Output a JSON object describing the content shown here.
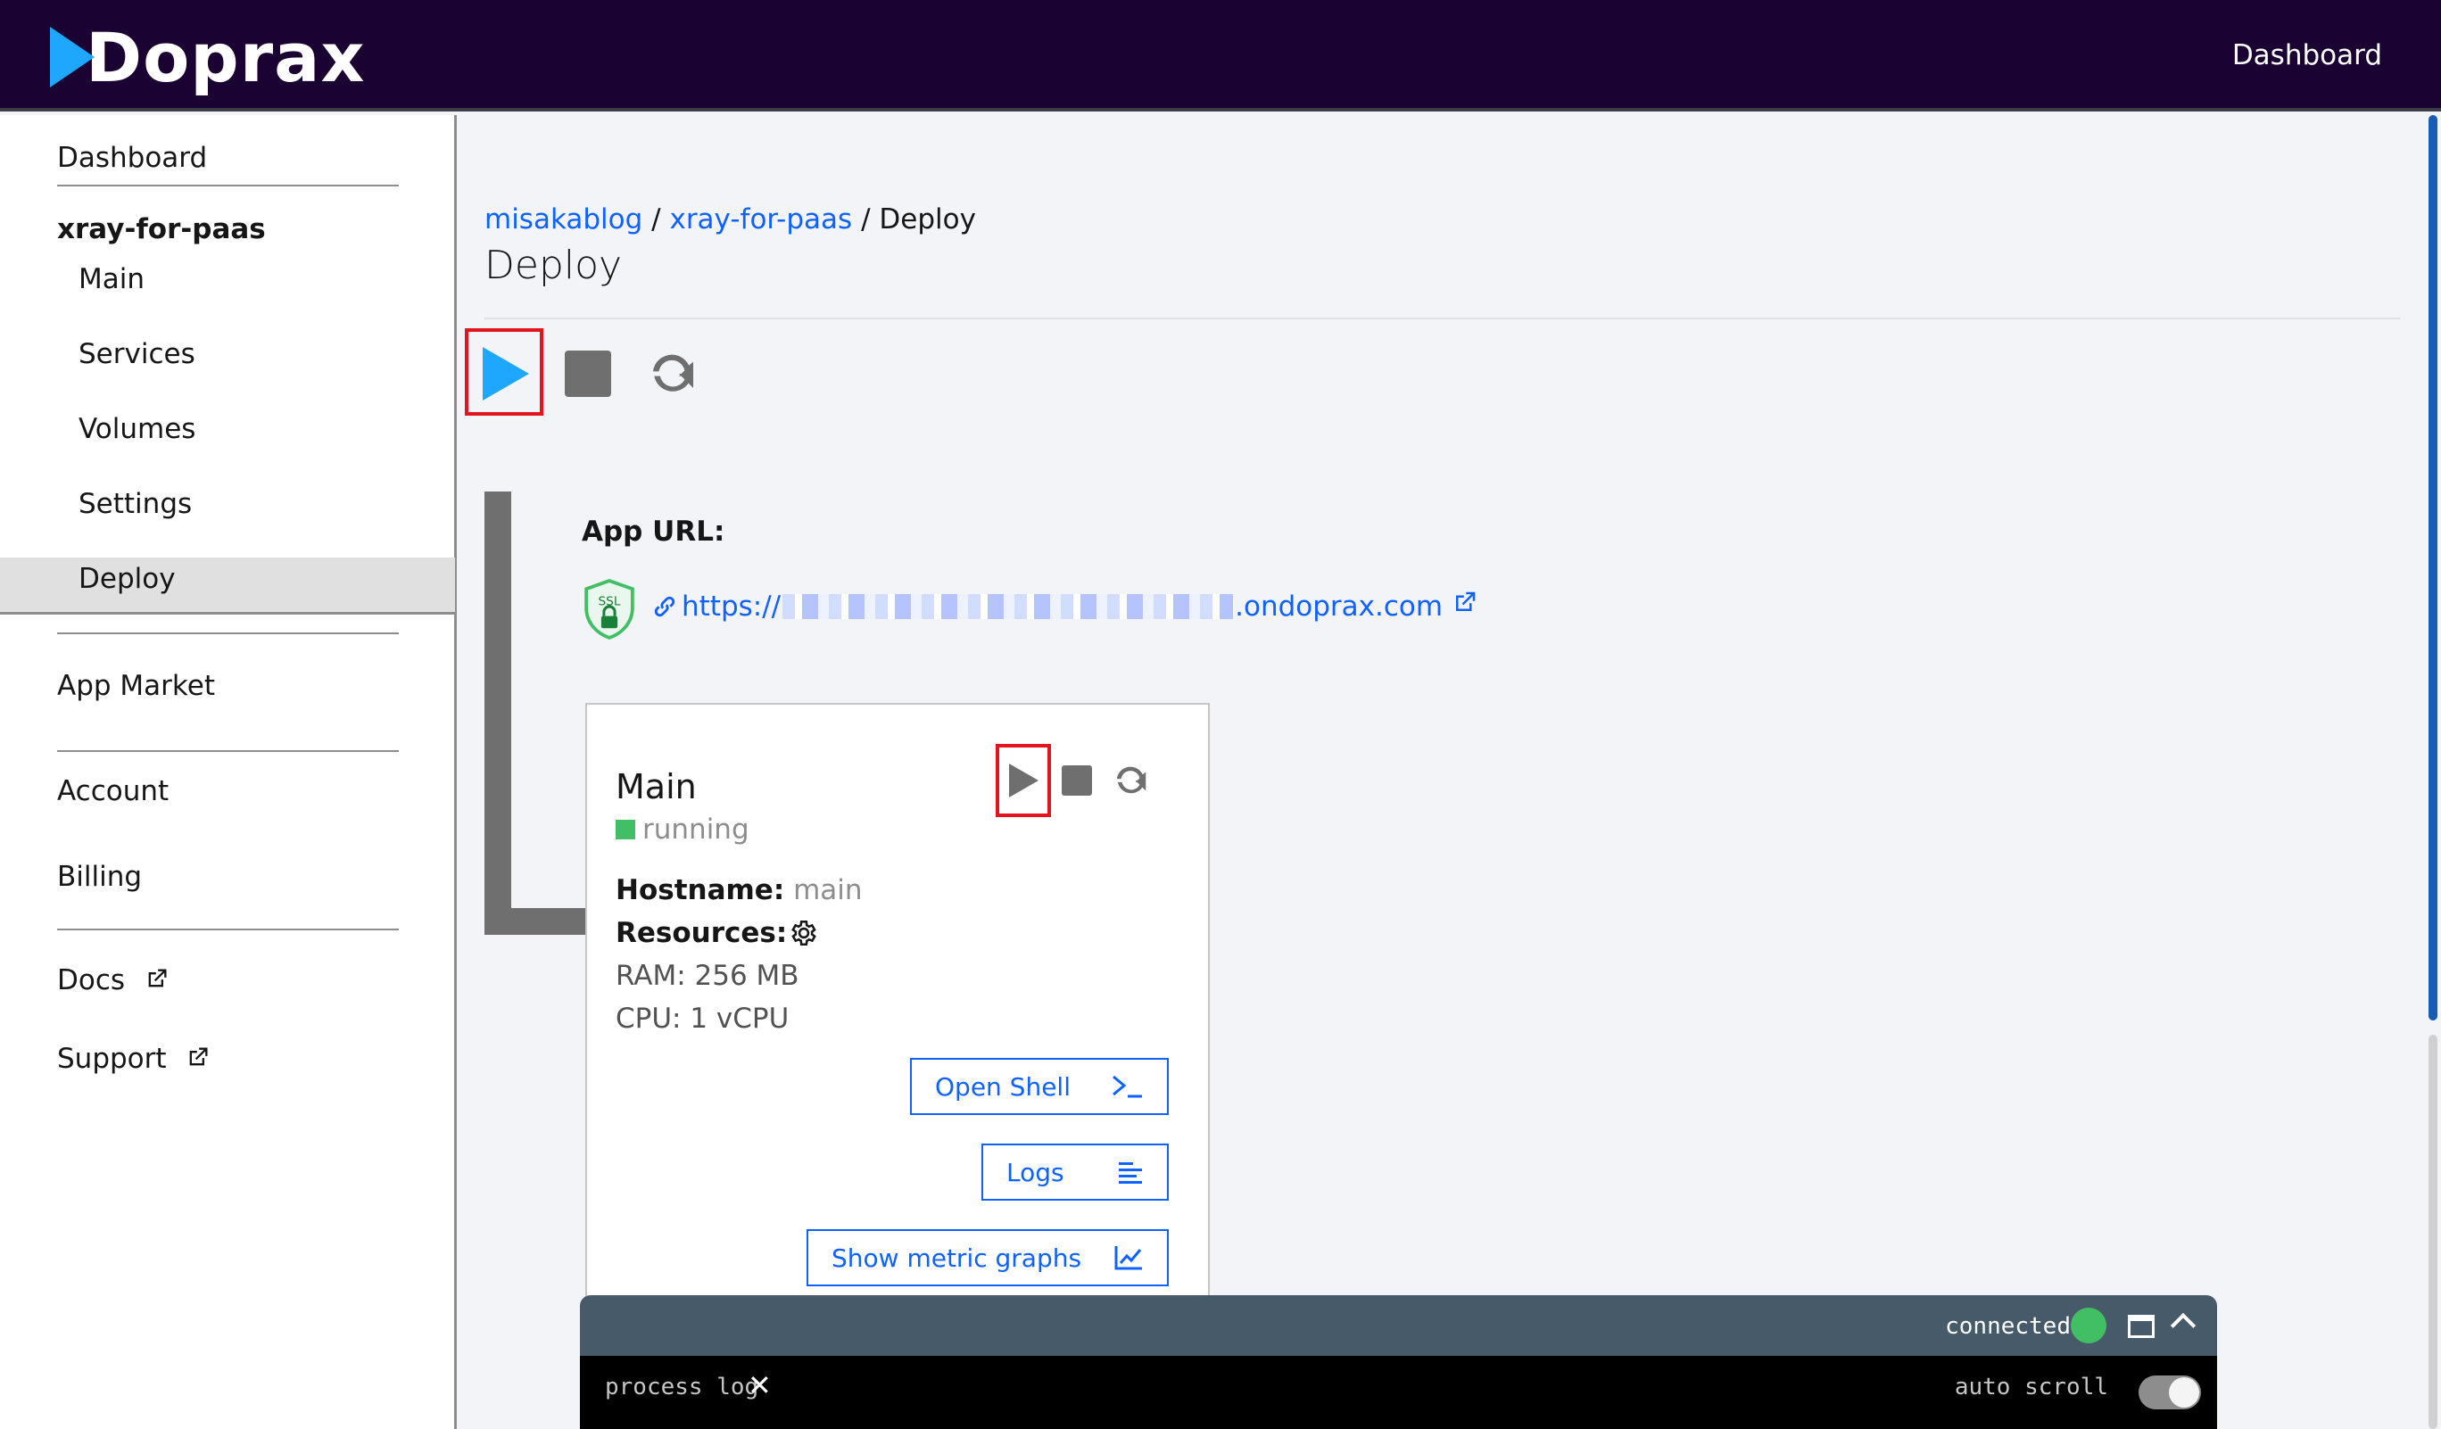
{
  "header": {
    "logo_text": "Doprax",
    "nav_dashboard": "Dashboard"
  },
  "sidebar": {
    "dashboard": "Dashboard",
    "app_name": "xray-for-paas",
    "items": [
      {
        "label": "Main"
      },
      {
        "label": "Services"
      },
      {
        "label": "Volumes"
      },
      {
        "label": "Settings"
      },
      {
        "label": "Deploy",
        "active": true
      }
    ],
    "app_market": "App Market",
    "account": "Account",
    "billing": "Billing",
    "docs": "Docs",
    "support": "Support"
  },
  "breadcrumb": {
    "root": "misakablog",
    "sep1": "/",
    "app": "xray-for-paas",
    "sep2": "/",
    "current": "Deploy"
  },
  "page": {
    "title": "Deploy"
  },
  "toolbar": {
    "play_icon": "play-icon",
    "stop_icon": "stop-icon",
    "restart_icon": "restart-icon"
  },
  "app_url": {
    "label": "App URL:",
    "ssl_badge": "SSL",
    "url_prefix": "https://",
    "url_suffix": ".ondoprax.com"
  },
  "service_card": {
    "title": "Main",
    "status": "running",
    "hostname_label": "Hostname:",
    "hostname_value": "main",
    "resources_label": "Resources:",
    "ram": "RAM: 256 MB",
    "cpu": "CPU: 1 vCPU",
    "open_shell": "Open Shell",
    "logs": "Logs",
    "show_metric_graphs": "Show metric graphs"
  },
  "log_panel": {
    "status": "connected",
    "tab_label": "process log",
    "auto_scroll": "auto scroll"
  },
  "colors": {
    "topbar_bg": "#1a0332",
    "accent_blue": "#0f62fe",
    "logo_blue": "#1ea7fd",
    "status_green": "#42be65",
    "highlight_red": "#e3141e",
    "log_header": "#475a69"
  }
}
